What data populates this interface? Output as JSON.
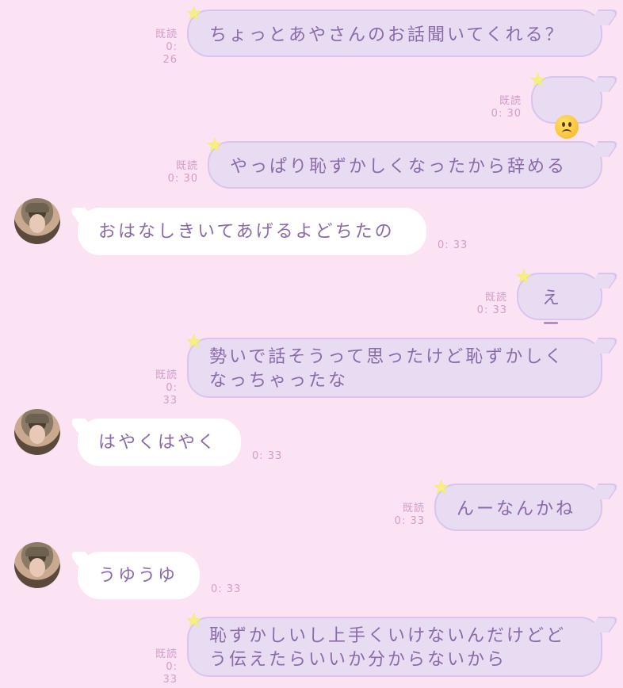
{
  "theme": {
    "background": "#fbe3f3",
    "sent_bubble": "#e8dcf3",
    "received_bubble": "#ffffff",
    "text": "#8a6aa8",
    "meta": "#d59cc9"
  },
  "messages": [
    {
      "side": "sent",
      "text": "ちょっとあやさんのお話聞いてくれる？",
      "read": "既読",
      "time": "0: 26"
    },
    {
      "side": "sent",
      "emoji": "frowning-face",
      "read": "既読",
      "time": "0: 30"
    },
    {
      "side": "sent",
      "text": "やっぱり恥ずかしくなったから辞める",
      "read": "既読",
      "time": "0: 30"
    },
    {
      "side": "received",
      "text": "おはなしきいてあげるよどちたの",
      "time": "0: 33"
    },
    {
      "side": "sent",
      "text": "えー",
      "read": "既読",
      "time": "0: 33"
    },
    {
      "side": "sent",
      "text": "勢いで話そうって思ったけど恥ずかしく\nなっちゃったな",
      "read": "既読",
      "time": "0: 33"
    },
    {
      "side": "received",
      "text": "はやくはやく",
      "time": "0: 33"
    },
    {
      "side": "sent",
      "text": "んーなんかね",
      "read": "既読",
      "time": "0: 33"
    },
    {
      "side": "received",
      "text": "うゆうゆ",
      "time": "0: 33"
    },
    {
      "side": "sent",
      "text": "恥ずかしいし上手くいけないんだけどど\nう伝えたらいいか分からないから",
      "read": "既読",
      "time": "0: 33"
    }
  ]
}
